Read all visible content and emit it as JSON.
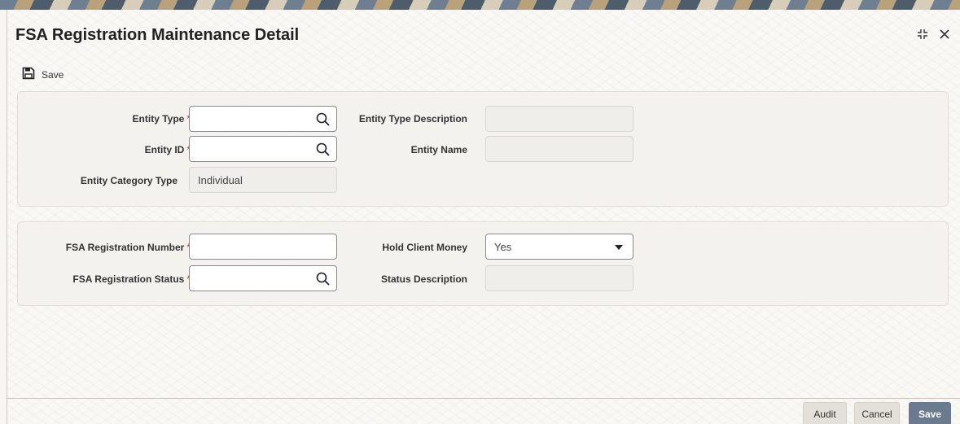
{
  "window": {
    "title": "FSA Registration Maintenance Detail"
  },
  "toolbar": {
    "save_label": "Save"
  },
  "entity_section": {
    "entity_type": {
      "label": "Entity Type",
      "required": "*",
      "value": ""
    },
    "entity_type_description": {
      "label": "Entity Type Description",
      "value": ""
    },
    "entity_id": {
      "label": "Entity ID",
      "required": "*",
      "value": ""
    },
    "entity_name": {
      "label": "Entity Name",
      "value": ""
    },
    "entity_category_type": {
      "label": "Entity Category Type",
      "value": "Individual"
    }
  },
  "registration_section": {
    "fsa_registration_number": {
      "label": "FSA Registration Number",
      "required": "*",
      "value": ""
    },
    "hold_client_money": {
      "label": "Hold Client Money",
      "value": "Yes"
    },
    "fsa_registration_status": {
      "label": "FSA Registration Status",
      "required": "*",
      "value": ""
    },
    "status_description": {
      "label": "Status Description",
      "value": ""
    }
  },
  "footer": {
    "audit_label": "Audit",
    "cancel_label": "Cancel",
    "save_label": "Save"
  },
  "colors": {
    "required_marker": "#c0392b",
    "primary_button": "#6b7a8f",
    "readonly_field": "#efeeea"
  },
  "icons": [
    "save-icon",
    "search-icon",
    "dropdown-caret-icon",
    "minimize-icon",
    "close-icon"
  ]
}
